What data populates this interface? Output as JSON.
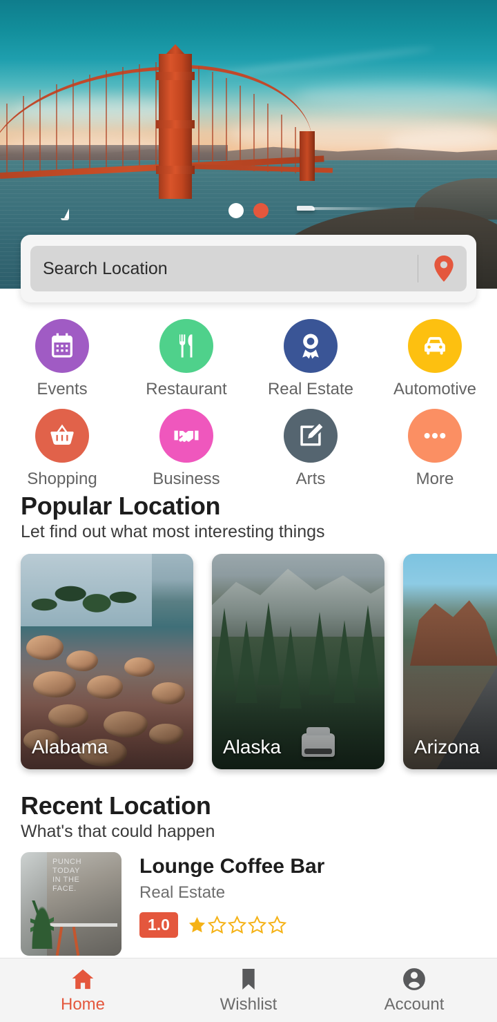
{
  "hero": {
    "image_alt": "Golden Gate Bridge at sunset",
    "carousel": {
      "dots": [
        {
          "name": "slide-1",
          "active": false,
          "color": "#ffffff"
        },
        {
          "name": "slide-2",
          "active": true,
          "color": "#e4573d"
        }
      ]
    }
  },
  "search": {
    "placeholder": "Search Location",
    "value": "",
    "pin_icon": "map-pin-icon",
    "pin_color": "#e4573d"
  },
  "categories": [
    {
      "label": "Events",
      "icon": "calendar-icon",
      "color": "#a05bc4"
    },
    {
      "label": "Restaurant",
      "icon": "cutlery-icon",
      "color": "#4fd18b"
    },
    {
      "label": "Real Estate",
      "icon": "award-icon",
      "color": "#3a5596"
    },
    {
      "label": "Automotive",
      "icon": "car-icon",
      "color": "#fdc010"
    },
    {
      "label": "Shopping",
      "icon": "basket-icon",
      "color": "#e1624a"
    },
    {
      "label": "Business",
      "icon": "handshake-icon",
      "color": "#ef57bd"
    },
    {
      "label": "Arts",
      "icon": "edit-icon",
      "color": "#556570"
    },
    {
      "label": "More",
      "icon": "dots-icon",
      "color": "#fb8f63"
    }
  ],
  "popular": {
    "title": "Popular Location",
    "subtitle": "Let find out what most interesting things",
    "cards": [
      {
        "name": "Alabama",
        "image_alt": "rocky lake shore with pine trees"
      },
      {
        "name": "Alaska",
        "image_alt": "pine forest with SUV on road"
      },
      {
        "name": "Arizona",
        "image_alt": "red rock canyon road"
      }
    ]
  },
  "recent": {
    "title": "Recent Location",
    "subtitle": "What's that could happen",
    "items": [
      {
        "title": "Lounge Coffee Bar",
        "category": "Real Estate",
        "rating": "1.0",
        "stars_filled": 1,
        "stars_total": 5,
        "badge_color": "#e4573d",
        "star_color": "#f5b216",
        "thumb_text": "PUNCH\nTODAY\nIN THE\nFACE.",
        "image_alt": "industrial cafe interior with wall slogan"
      }
    ]
  },
  "bottom_nav": {
    "active_color": "#e4573d",
    "inactive_color": "#6b6b6b",
    "items": [
      {
        "label": "Home",
        "icon": "home-icon",
        "active": true
      },
      {
        "label": "Wishlist",
        "icon": "bookmark-icon",
        "active": false
      },
      {
        "label": "Account",
        "icon": "user-icon",
        "active": false
      }
    ]
  }
}
